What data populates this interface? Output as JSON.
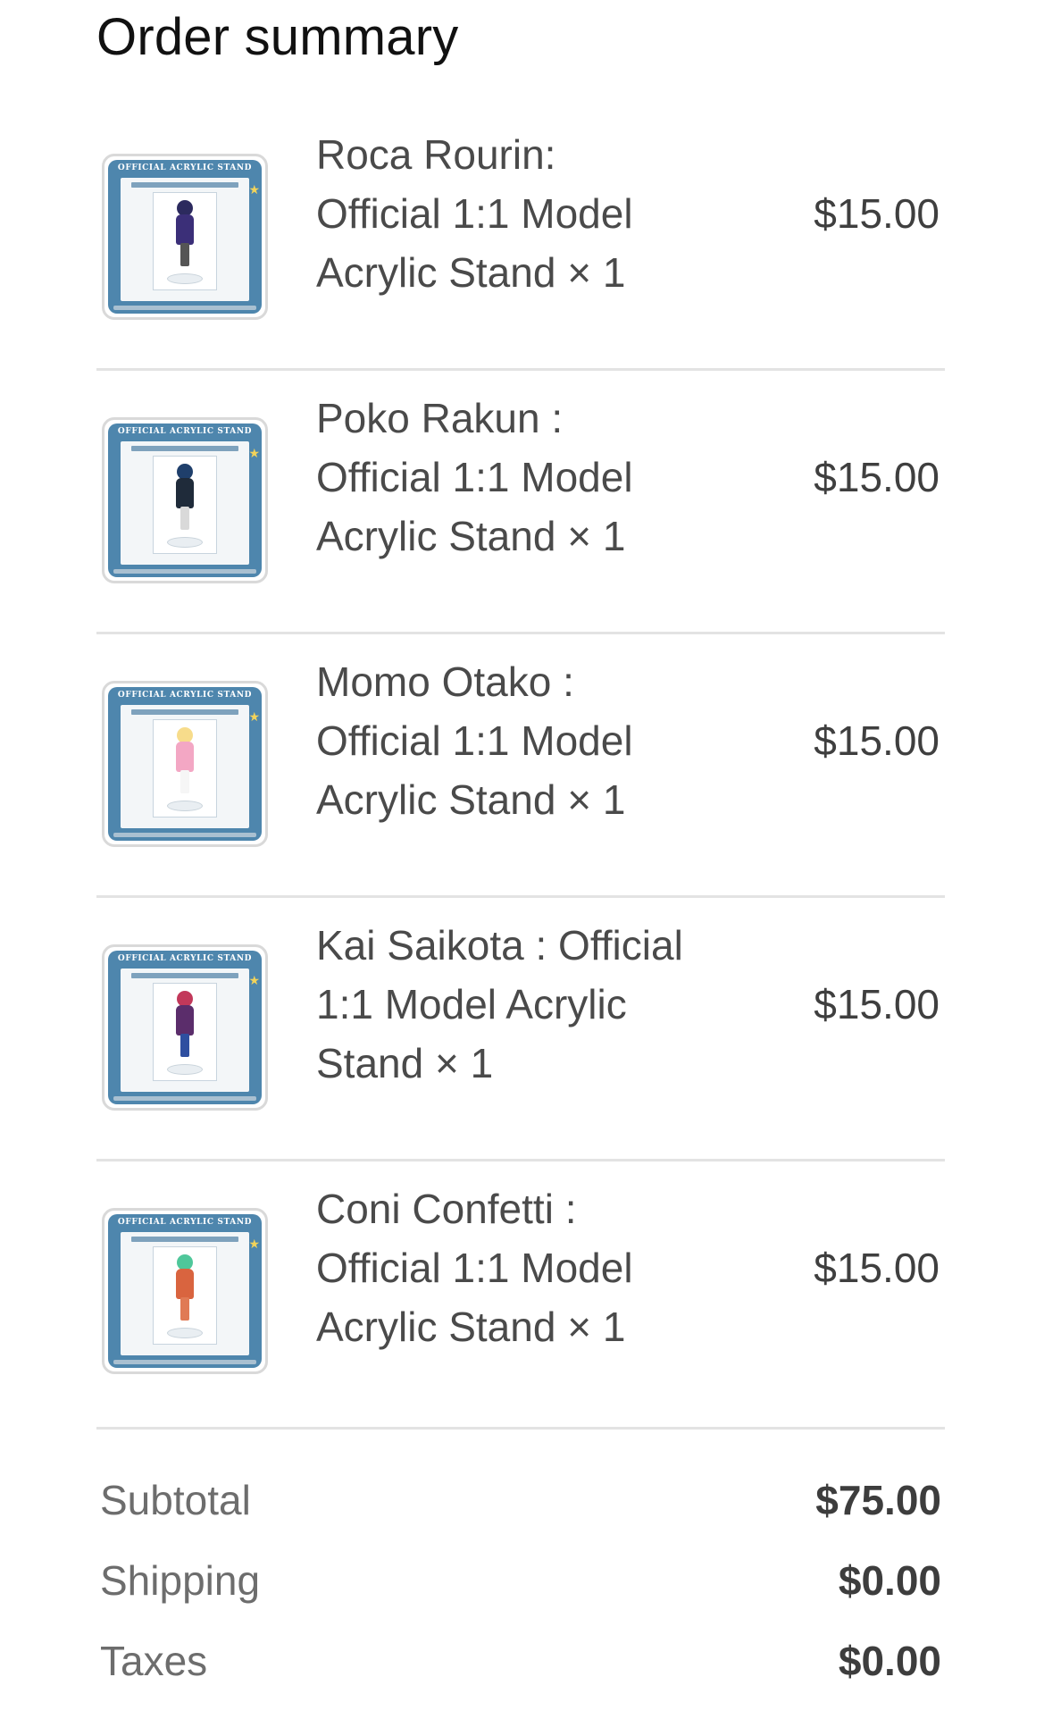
{
  "title": "Order summary",
  "items": [
    {
      "name": "Roca Rourin: Official 1:1 Model Acrylic Stand × 1",
      "price": "$15.00",
      "thumb_label": "OFFICIAL ACRYLIC STAND",
      "figure_colors": {
        "hair": "#2c2a5e",
        "body": "#3b2f78",
        "legs": "#555555"
      }
    },
    {
      "name": "Poko Rakun : Official 1:1 Model Acrylic Stand × 1",
      "price": "$15.00",
      "thumb_label": "OFFICIAL ACRYLIC STAND",
      "figure_colors": {
        "hair": "#1f3f6b",
        "body": "#1f2b3a",
        "legs": "#d9d9d9"
      }
    },
    {
      "name": "Momo Otako : Official 1:1 Model Acrylic Stand × 1",
      "price": "$15.00",
      "thumb_label": "OFFICIAL ACRYLIC STAND",
      "figure_colors": {
        "hair": "#f7dc8b",
        "body": "#f3a7c4",
        "legs": "#f6f6f6"
      }
    },
    {
      "name": "Kai Saikota : Official 1:1 Model Acrylic Stand × 1",
      "price": "$15.00",
      "thumb_label": "OFFICIAL ACRYLIC STAND",
      "figure_colors": {
        "hair": "#c2385a",
        "body": "#5b2d6b",
        "legs": "#2e4fa0"
      }
    },
    {
      "name": "Coni Confetti : Official 1:1 Model Acrylic Stand × 1",
      "price": "$15.00",
      "thumb_label": "OFFICIAL ACRYLIC STAND",
      "figure_colors": {
        "hair": "#4fc79a",
        "body": "#d9643f",
        "legs": "#e07a55"
      }
    }
  ],
  "totals": {
    "subtotal_label": "Subtotal",
    "subtotal_value": "$75.00",
    "shipping_label": "Shipping",
    "shipping_value": "$0.00",
    "taxes_label": "Taxes",
    "taxes_value": "$0.00"
  }
}
